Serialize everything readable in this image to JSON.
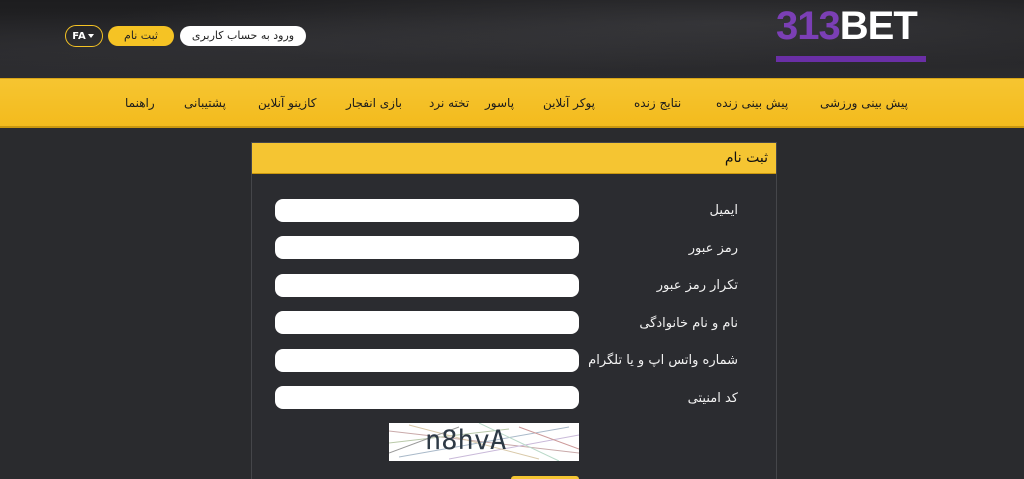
{
  "header": {
    "logo": {
      "prefix": "313",
      "suffix": "BET"
    },
    "login_label": "ورود به حساب کاربری",
    "register_label": "ثبت نام",
    "lang_label": "FA"
  },
  "nav": {
    "items": [
      "پیش بینی ورزشی",
      "پیش بینی زنده",
      "نتایج زنده",
      "پوکر آنلاین",
      "پاسور",
      "تخته نرد",
      "بازی انفجار",
      "کازینو آنلاین",
      "پشتیبانی",
      "راهنما"
    ]
  },
  "form": {
    "title": "ثبت نام",
    "fields": [
      {
        "label": "ایمیل",
        "value": ""
      },
      {
        "label": "رمز عبور",
        "value": ""
      },
      {
        "label": "تکرار رمز عبور",
        "value": ""
      },
      {
        "label": "نام و نام خانوادگی",
        "value": ""
      },
      {
        "label": "شماره واتس اپ و یا تلگرام",
        "value": ""
      },
      {
        "label": "کد امنیتی",
        "value": ""
      }
    ],
    "captcha_text": "n8hvA"
  },
  "colors": {
    "accent": "#f5c532",
    "brand_purple": "#7b3fb5",
    "background": "#2a2b2e"
  }
}
